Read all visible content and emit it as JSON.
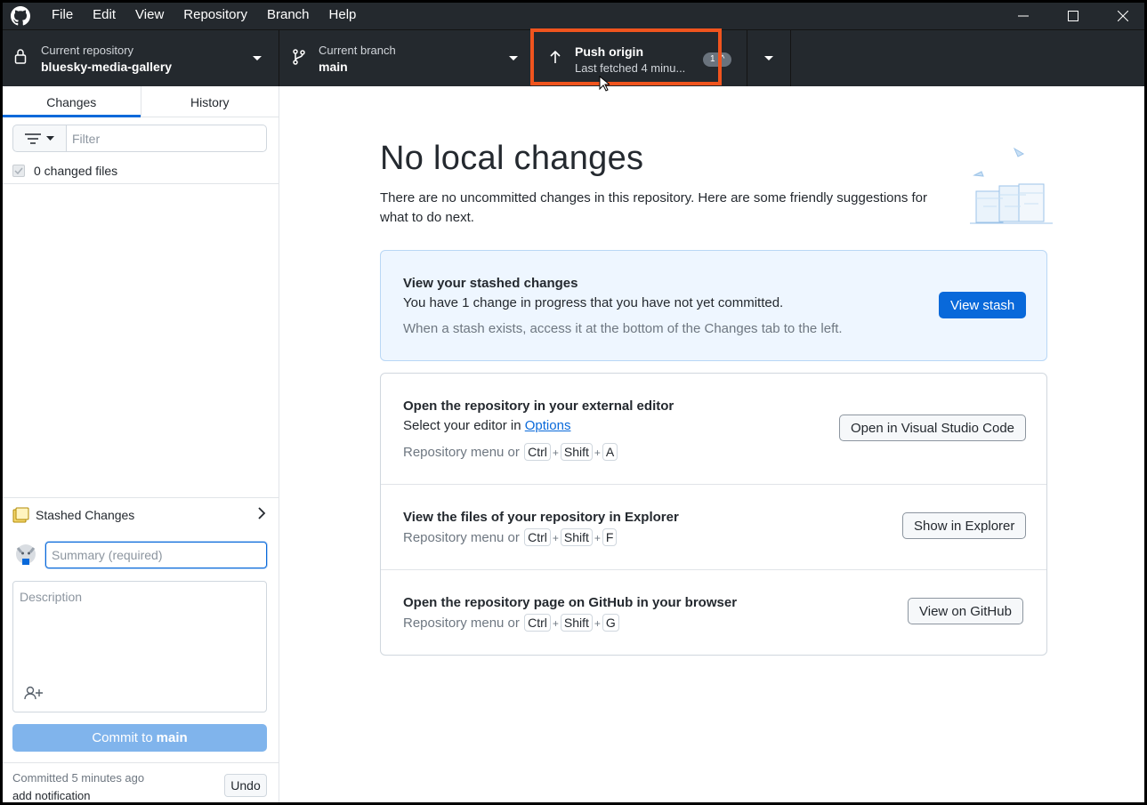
{
  "menu": [
    "File",
    "Edit",
    "View",
    "Repository",
    "Branch",
    "Help"
  ],
  "toolbar": {
    "repo_label": "Current repository",
    "repo_value": "bluesky-media-gallery",
    "branch_label": "Current branch",
    "branch_value": "main",
    "push_label": "Push origin",
    "push_sub": "Last fetched 4 minu...",
    "push_count": "1"
  },
  "sidebar": {
    "tabs": [
      "Changes",
      "History"
    ],
    "filter_placeholder": "Filter",
    "changed_files": "0 changed files",
    "stashed_label": "Stashed Changes",
    "summary_placeholder": "Summary (required)",
    "description_placeholder": "Description",
    "commit_prefix": "Commit to",
    "commit_branch": "main",
    "last_commit_time": "Committed 5 minutes ago",
    "last_commit_msg": "add notification",
    "undo_label": "Undo"
  },
  "main": {
    "title": "No local changes",
    "intro": "There are no uncommitted changes in this repository. Here are some friendly suggestions for what to do next.",
    "stash_card": {
      "title": "View your stashed changes",
      "text": "You have 1 change in progress that you have not yet committed.",
      "sub": "When a stash exists, access it at the bottom of the Changes tab to the left.",
      "button": "View stash"
    },
    "editor_card": {
      "title": "Open the repository in your external editor",
      "text_prefix": "Select your editor in",
      "text_link": "Options",
      "shortcut_prefix": "Repository menu or",
      "keys": [
        "Ctrl",
        "Shift",
        "A"
      ],
      "button": "Open in Visual Studio Code"
    },
    "explorer_card": {
      "title": "View the files of your repository in Explorer",
      "shortcut_prefix": "Repository menu or",
      "keys": [
        "Ctrl",
        "Shift",
        "F"
      ],
      "button": "Show in Explorer"
    },
    "github_card": {
      "title": "Open the repository page on GitHub in your browser",
      "shortcut_prefix": "Repository menu or",
      "keys": [
        "Ctrl",
        "Shift",
        "G"
      ],
      "button": "View on GitHub"
    }
  },
  "colors": {
    "accent": "#0969da",
    "highlight": "#f0541e",
    "toolbar_bg": "#24292e"
  }
}
